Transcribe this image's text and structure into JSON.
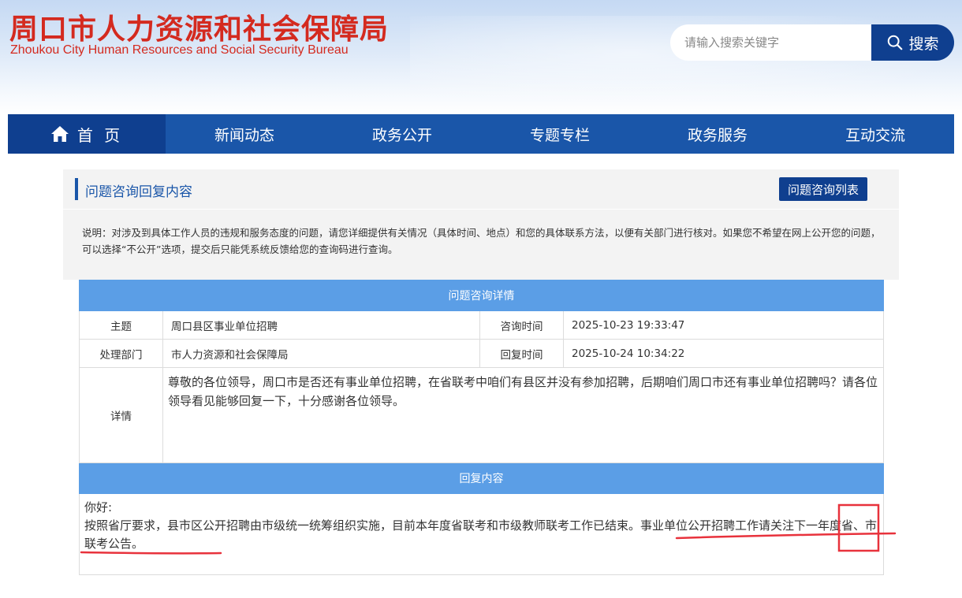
{
  "header": {
    "title_cn": "周口市人力资源和社会保障局",
    "title_en": "Zhoukou City Human Resources and Social Security Bureau",
    "search_placeholder": "请输入搜索关键字",
    "search_button": "搜索"
  },
  "nav": {
    "items": [
      "首 页",
      "新闻动态",
      "政务公开",
      "专题专栏",
      "政务服务",
      "互动交流"
    ]
  },
  "panel": {
    "title": "问题咨询回复内容",
    "list_button": "问题咨询列表",
    "notice": "说明：对涉及到具体工作人员的违规和服务态度的问题，请您详细提供有关情况（具体时间、地点）和您的具体联系方法，以便有关部门进行核对。如果您不希望在网上公开您的问题， 可以选择“不公开”选项，提交后只能凭系统反馈给您的查询码进行查询。"
  },
  "detail": {
    "section_title": "问题咨询详情",
    "subject_label": "主题",
    "subject": "周口县区事业单位招聘",
    "consult_time_label": "咨询时间",
    "consult_time": "2025-10-23 19:33:47",
    "department_label": "处理部门",
    "department": "市人力资源和社会保障局",
    "reply_time_label": "回复时间",
    "reply_time": "2025-10-24 10:34:22",
    "content_label": "详情",
    "content": "尊敬的各位领导，周口市是否还有事业单位招聘，在省联考中咱们有县区并没有参加招聘，后期咱们周口市还有事业单位招聘吗？请各位领导看见能够回复一下，十分感谢各位领导。"
  },
  "reply": {
    "section_title": "回复内容",
    "greeting": "你好:",
    "body": "按照省厅要求，县市区公开招聘由市级统一统筹组织实施，目前本年度省联考和市级教师联考工作已结束。事业单位公开招聘工作请关注下一年度省、市联考公告。"
  },
  "annotation": {
    "color": "#e8323c"
  }
}
